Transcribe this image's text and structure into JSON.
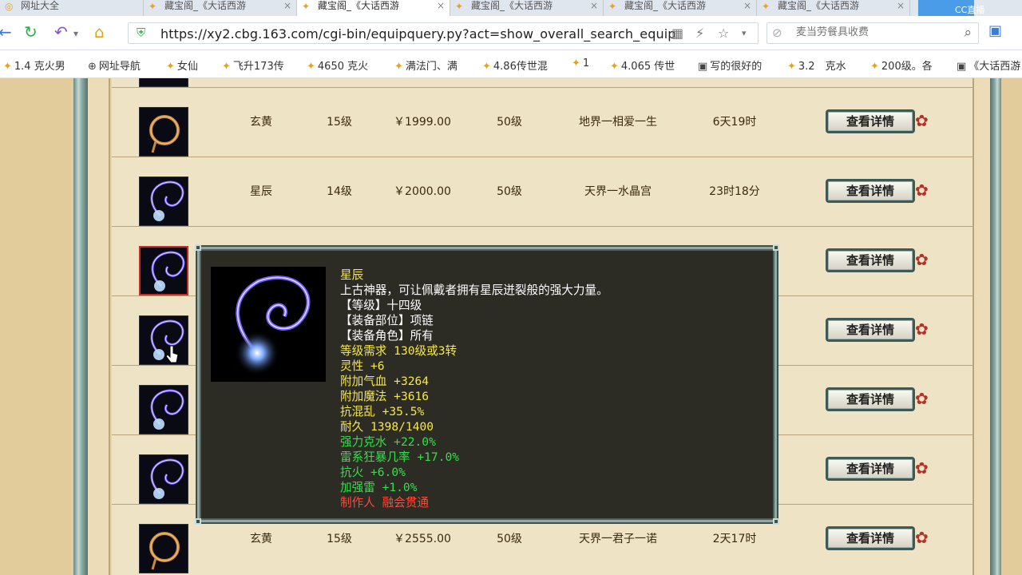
{
  "tabs": [
    {
      "label": "网址大全",
      "active": false
    },
    {
      "label": "藏宝阁_《大话西游",
      "active": false
    },
    {
      "label": "藏宝阁_《大话西游",
      "active": true
    },
    {
      "label": "藏宝阁_《大话西游",
      "active": false
    },
    {
      "label": "藏宝阁_《大话西游",
      "active": false
    },
    {
      "label": "藏宝阁_《大话西游",
      "active": false
    }
  ],
  "tab_right_text": "CC直播",
  "url": "https://xy2.cbg.163.com/cgi-bin/equipquery.py?act=show_overall_search_equip",
  "search": {
    "placeholder": "麦当劳餐具收费"
  },
  "bookmarks": [
    "1.4 克火男",
    "网址导航",
    "女仙",
    "飞升173传",
    "4650 克火",
    "满法门、满",
    "4.86传世混",
    "1",
    "4.065 传世",
    "写的很好的",
    "3.2　克水",
    "200级。各",
    "《大话西游"
  ],
  "rows": [
    {
      "name": "玄黄",
      "level": "15级",
      "price": "￥1999.00",
      "req": "50级",
      "server": "地界一相爱一生",
      "time": "6天19时",
      "icon": "ring-gold",
      "selected": false
    },
    {
      "name": "星辰",
      "level": "14级",
      "price": "￥2000.00",
      "req": "50级",
      "server": "天界一水晶宫",
      "time": "23时18分",
      "icon": "necklace-blue",
      "selected": false
    },
    {
      "name": "",
      "level": "",
      "price": "",
      "req": "",
      "server": "",
      "time": "",
      "icon": "necklace-blue",
      "selected": true
    },
    {
      "name": "",
      "level": "",
      "price": "",
      "req": "",
      "server": "",
      "time": "",
      "icon": "necklace-blue",
      "selected": false
    },
    {
      "name": "",
      "level": "",
      "price": "",
      "req": "",
      "server": "",
      "time": "",
      "icon": "necklace-blue",
      "selected": false
    },
    {
      "name": "",
      "level": "",
      "price": "",
      "req": "",
      "server": "",
      "time": "",
      "icon": "necklace-blue",
      "selected": false
    },
    {
      "name": "玄黄",
      "level": "15级",
      "price": "￥2555.00",
      "req": "50级",
      "server": "天界一君子一诺",
      "time": "2天17时",
      "icon": "ring-gold",
      "selected": false
    }
  ],
  "detail_label": "查看详情",
  "popup": {
    "lines": [
      {
        "text": "星辰",
        "color": "title"
      },
      {
        "text": "上古神器，可让佩戴者拥有星辰迸裂般的强大力量。",
        "color": "white"
      },
      {
        "text": "【等级】十四级",
        "color": "white"
      },
      {
        "text": "【装备部位】项链",
        "color": "white"
      },
      {
        "text": "【装备角色】所有",
        "color": "white"
      },
      {
        "text": "等级需求 130级或3转",
        "color": "yellow"
      },
      {
        "text": "灵性 +6",
        "color": "yellow"
      },
      {
        "text": "附加气血 +3264",
        "color": "yellow"
      },
      {
        "text": "附加魔法 +3616",
        "color": "yellow"
      },
      {
        "text": "抗混乱 +35.5%",
        "color": "yellow"
      },
      {
        "text": "耐久 1398/1400",
        "color": "yellow"
      },
      {
        "text": "强力克水 +22.0%",
        "color": "green"
      },
      {
        "text": "雷系狂暴几率 +17.0%",
        "color": "green"
      },
      {
        "text": "抗火 +6.0%",
        "color": "green"
      },
      {
        "text": "加强雷 +1.0%",
        "color": "green"
      },
      {
        "text": "制作人 融会贯通",
        "color": "red"
      }
    ]
  }
}
